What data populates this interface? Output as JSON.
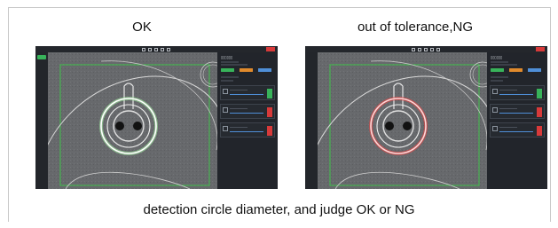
{
  "labels": {
    "ok_title": "OK",
    "ng_title": "out of tolerance,NG",
    "caption": "detection circle diameter, and judge OK or NG"
  },
  "screenshots": [
    {
      "id": "ok",
      "status": "OK",
      "ring_color": "#ffffff",
      "ring_glow": "#9be39b",
      "roi_color": "#3fbf4a"
    },
    {
      "id": "ng",
      "status": "NG",
      "ring_color": "#ffd6d6",
      "ring_glow": "#e64646",
      "roi_color": "#3fbf4a"
    }
  ],
  "colors": {
    "run_button": "#38b35a",
    "close_button": "#d83a3a",
    "panel_blue": "#4f8fd8",
    "panel_orange": "#e08a2c",
    "panel_red": "#d83a3a",
    "panel_green": "#38b35a"
  },
  "icons": [
    "run-icon",
    "close-icon",
    "toolbar-icons",
    "image-icon"
  ]
}
